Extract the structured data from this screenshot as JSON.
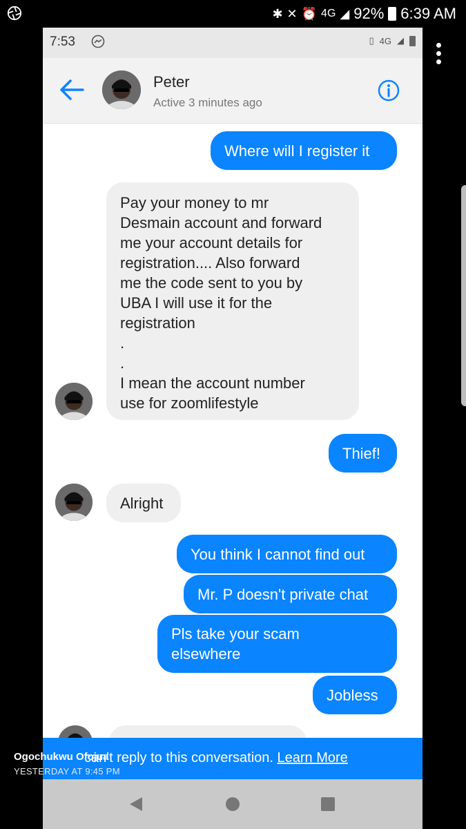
{
  "outer_status": {
    "signal_label": "4G",
    "battery": "92%",
    "time": "6:39 AM"
  },
  "inner_status": {
    "time": "7:53",
    "signal_label": "4G"
  },
  "header": {
    "name": "Peter",
    "status": "Active 3 minutes ago"
  },
  "messages": [
    {
      "from": "me",
      "text": "Where will I register it"
    },
    {
      "from": "peter",
      "lines": [
        "Pay your money to mr",
        "Desmain account and forward",
        "me your account details for",
        "registration.... Also forward",
        "me the code sent to you by",
        "UBA I will use it for the",
        "registration",
        ".",
        ".",
        "I mean the account number",
        "use for zoomlifestyle"
      ]
    },
    {
      "from": "me",
      "text": "Thief!"
    },
    {
      "from": "peter",
      "text": "Alright"
    },
    {
      "from": "me",
      "text": "You think I cannot find out"
    },
    {
      "from": "me",
      "text": "Mr. P doesn't private chat"
    },
    {
      "from": "me",
      "lines": [
        "Pls take your scam",
        "elsewhere"
      ]
    },
    {
      "from": "me",
      "text": "Jobless"
    }
  ],
  "banner": {
    "text": "can't reply to this conversation.",
    "link": "Learn More"
  },
  "post_overlay": {
    "author": "Ogochukwu Ofojua",
    "time": "YESTERDAY AT 9:45 PM"
  },
  "colors": {
    "accent": "#0a84ff",
    "incoming_bubble": "#efefef"
  }
}
